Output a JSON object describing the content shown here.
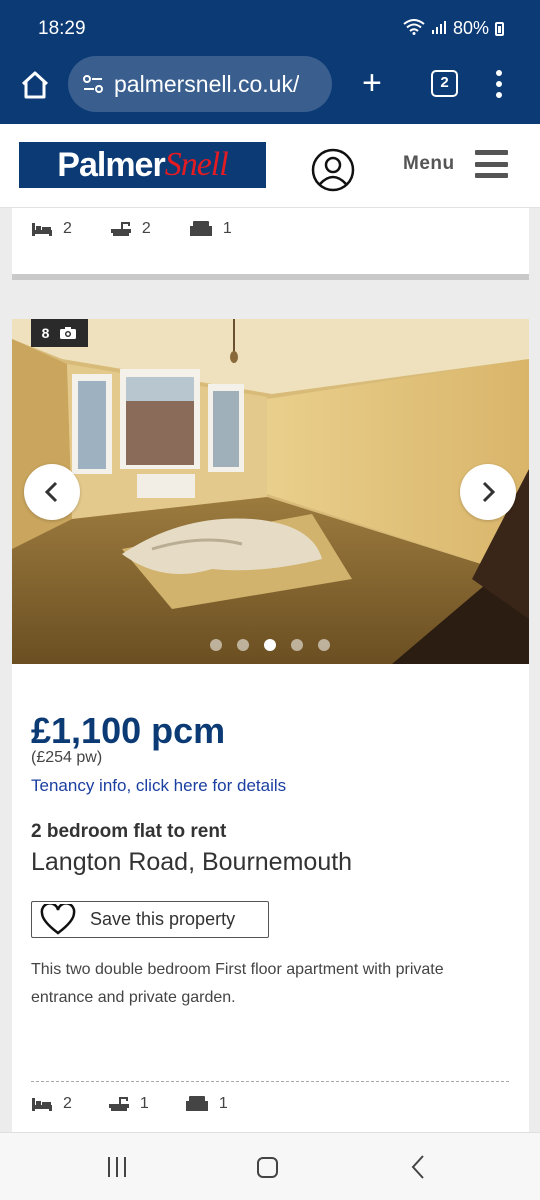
{
  "status_bar": {
    "time": "18:29",
    "battery": "80%"
  },
  "browser": {
    "url": "palmersnell.co.uk/",
    "tab_count": "2"
  },
  "site": {
    "logo_part1": "Palmer",
    "logo_part2": "Snell",
    "menu_label": "Menu"
  },
  "previous_listing": {
    "features": [
      {
        "icon": "bed-icon",
        "value": "2"
      },
      {
        "icon": "bath-icon",
        "value": "2"
      },
      {
        "icon": "sofa-icon",
        "value": "1"
      }
    ]
  },
  "listing": {
    "photo_count": "8",
    "gallery_total": 5,
    "gallery_active": 3,
    "price": "£1,100 pcm",
    "price_weekly": "(£254 pw)",
    "tenancy_link": "Tenancy info, click here for details",
    "type": "2 bedroom flat to rent",
    "address": "Langton Road, Bournemouth",
    "save_label": "Save this property",
    "description": "This two double bedroom First floor apartment with private entrance and private garden.",
    "features": [
      {
        "icon": "bed-icon",
        "value": "2"
      },
      {
        "icon": "bath-icon",
        "value": "1"
      },
      {
        "icon": "sofa-icon",
        "value": "1"
      }
    ]
  },
  "colors": {
    "brand_navy": "#0b3a75",
    "brand_red": "#e31b23",
    "link": "#1a3fa0"
  }
}
